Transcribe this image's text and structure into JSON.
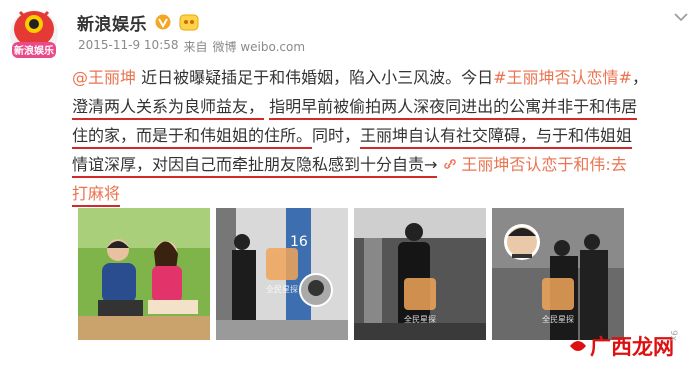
{
  "post": {
    "author": "新浪娱乐",
    "avatar_text": "新浪娱乐",
    "timestamp": "2015-11-9 10:58",
    "source_prefix": "来自",
    "source": "微博 weibo.com",
    "content_lines": [
      [
        {
          "t": "@王丽坤",
          "link": true
        },
        {
          "t": " 近日被曝疑插足于和伟婚姻，陷入小三风波。今日"
        },
        {
          "t": "#王丽坤否认恋情#",
          "link": true
        },
        {
          "t": "，"
        }
      ],
      [
        {
          "t": "澄清两人关系为良师益友，",
          "hl": true
        },
        {
          "t": " "
        },
        {
          "t": "指明早前被偷拍两人深夜同进出的公寓并非于和伟居",
          "hl": true
        }
      ],
      [
        {
          "t": "住的家，而是于和伟姐姐的住所。",
          "hl": true
        },
        {
          "t": "同时，"
        },
        {
          "t": "王丽坤自认有社交障碍，",
          "hl": true
        },
        {
          "t": "与于和伟姐姐",
          "hl": true
        }
      ],
      [
        {
          "t": "情谊深厚，对因自己而牵扯朋友隐私感到十分自责→",
          "hl": true
        },
        {
          "icon": true
        },
        {
          "t": "王丽坤否认恋于和伟:去",
          "link": true
        }
      ],
      [
        {
          "t": "打麻将",
          "link": true,
          "hl": true
        }
      ]
    ],
    "link_icon": "link-icon"
  },
  "photos": [
    {
      "name": "photo-couple-picnic",
      "watermark": ""
    },
    {
      "name": "photo-paparazzi-1",
      "watermark": "全民星探",
      "label": "16"
    },
    {
      "name": "photo-paparazzi-2",
      "watermark": "全民星探"
    },
    {
      "name": "photo-paparazzi-3",
      "watermark": "全民星探"
    }
  ],
  "watermark": {
    "text": "广西龙网",
    "small": "9x"
  },
  "colors": {
    "link": "#eb7350",
    "highlight": "#d22929",
    "meta": "#8a8a8a"
  },
  "icons": {
    "verified": "verified-v-icon",
    "badge": "fan-badge-icon",
    "menu": "chevron-down-icon"
  }
}
